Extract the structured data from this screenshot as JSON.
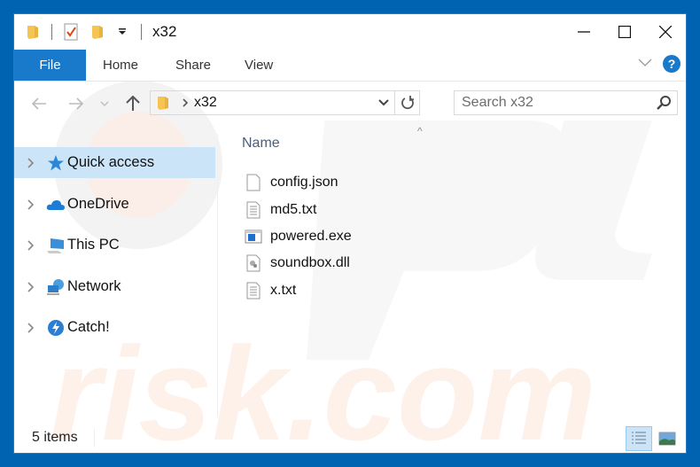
{
  "window": {
    "title": "x32",
    "controls": {
      "minimize": "minimize",
      "maximize": "maximize",
      "close": "close"
    }
  },
  "quick_access_toolbar": {
    "icons": [
      "folder-icon",
      "properties-icon",
      "new-folder-icon",
      "customize-dropdown-icon"
    ]
  },
  "ribbon": {
    "tabs": [
      {
        "label": "File",
        "active": true
      },
      {
        "label": "Home"
      },
      {
        "label": "Share"
      },
      {
        "label": "View"
      }
    ],
    "expand_icon": "chevron-down-icon",
    "help_label": "?"
  },
  "navigation": {
    "back": "back-arrow-icon",
    "forward": "forward-arrow-icon",
    "recent": "recent-locations-icon",
    "up": "up-arrow-icon"
  },
  "address_bar": {
    "path_segment": "x32",
    "separator": "›"
  },
  "search": {
    "placeholder": "Search x32",
    "value": ""
  },
  "sidebar": {
    "items": [
      {
        "label": "Quick access",
        "icon": "star-icon",
        "selected": true
      },
      {
        "label": "OneDrive",
        "icon": "cloud-icon"
      },
      {
        "label": "This PC",
        "icon": "computer-icon"
      },
      {
        "label": "Network",
        "icon": "network-icon"
      },
      {
        "label": "Catch!",
        "icon": "catch-icon"
      }
    ]
  },
  "file_list": {
    "column_header": "Name",
    "sort_indicator": "^",
    "files": [
      {
        "name": "config.json",
        "icon": "blank-file-icon"
      },
      {
        "name": "md5.txt",
        "icon": "text-file-icon"
      },
      {
        "name": "powered.exe",
        "icon": "exe-file-icon"
      },
      {
        "name": "soundbox.dll",
        "icon": "dll-file-icon"
      },
      {
        "name": "x.txt",
        "icon": "text-file-icon"
      }
    ]
  },
  "status_bar": {
    "item_count": "5 items",
    "views": [
      {
        "name": "details-view",
        "active": true
      },
      {
        "name": "large-icons-view",
        "active": false
      }
    ]
  },
  "colors": {
    "accent": "#1979ca",
    "frame": "#0063b1",
    "selection": "#cce4f7"
  }
}
